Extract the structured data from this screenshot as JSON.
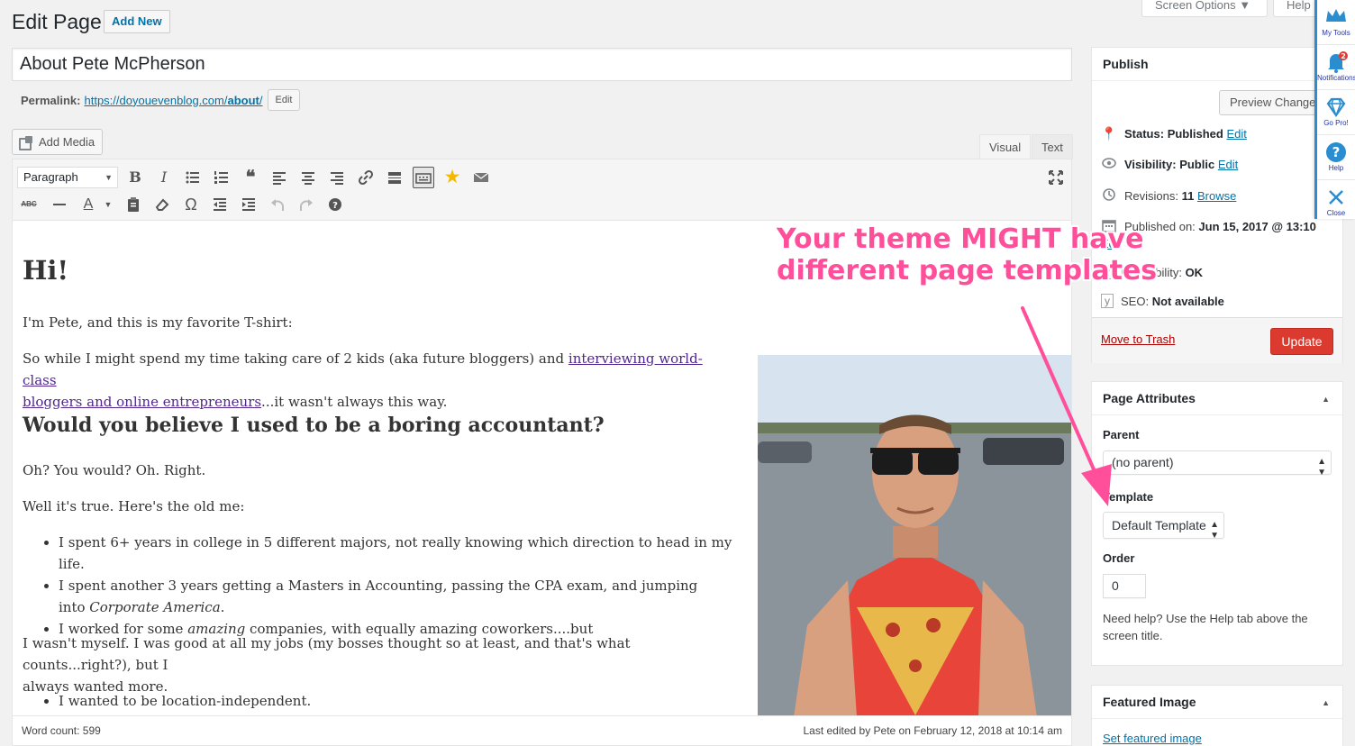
{
  "header": {
    "title": "Edit Page",
    "add_new": "Add New",
    "screen_options": "Screen Options ▼",
    "help": "Help"
  },
  "post": {
    "title": "About Pete McPherson",
    "permalink_label": "Permalink:",
    "permalink_base": "https://doyouevenblog.com/",
    "permalink_slug": "about",
    "permalink_end": "/",
    "permalink_edit": "Edit"
  },
  "editor": {
    "add_media": "Add Media",
    "tab_visual": "Visual",
    "tab_text": "Text",
    "format": "Paragraph",
    "content": {
      "h1": "Hi!",
      "p1": "I'm Pete, and this is my favorite T-shirt:",
      "p2_start": "So while I might spend my time taking care of 2 kids (aka future bloggers) and ",
      "p2_link_1": "interviewing world-class ",
      "p2_link_2": "bloggers and online entrepreneurs",
      "p2_end": "...it wasn't always this way.",
      "h2": "Would you believe I used to be a boring accountant?",
      "p3": "Oh? You would? Oh. Right.",
      "p4": "Well it's true. Here's the old me:",
      "li1": "I spent 6+ years in college in 5 different majors, not really knowing which direction to head in my life.",
      "li2_line1": "I spent another 3 years getting a Masters in Accounting, passing the CPA exam, and jumping",
      "li2_line2_pre": "into ",
      "li2_line2_em": "Corporate America",
      "li2_line2_post": ".",
      "li3_pre": "I worked for some ",
      "li3_em": "amazing",
      "li3_post": " companies, with equally amazing coworkers....but",
      "p5_line1": "I wasn't myself. I was good at all my jobs (my bosses thought so at least, and that's what counts...right?), but I",
      "p5_line2": "always wanted more.",
      "li4": "I wanted to be location-independent."
    },
    "word_count": "Word count: 599",
    "last_edited": "Last edited by Pete on February 12, 2018 at 10:14 am"
  },
  "publish": {
    "title": "Publish",
    "preview": "Preview Changes",
    "status_label": "Status:",
    "status_value": "Published",
    "visibility_label": "Visibility:",
    "visibility_value": "Public",
    "revisions_label": "Revisions:",
    "revisions_value": "11",
    "browse": "Browse",
    "published_label": "Published on:",
    "published_value": "Jun 15, 2017 @ 13:10",
    "edit": "Edit",
    "readability_label": "Readability:",
    "readability_value": "OK",
    "seo_label": "SEO:",
    "seo_value": "Not available",
    "trash": "Move to Trash",
    "update": "Update"
  },
  "attributes": {
    "title": "Page Attributes",
    "parent_label": "Parent",
    "parent_value": "(no parent)",
    "template_label": "Template",
    "template_value": "Default Template",
    "order_label": "Order",
    "order_value": "0",
    "help_text": "Need help? Use the Help tab above the screen title."
  },
  "featured": {
    "title": "Featured Image",
    "set": "Set featured image"
  },
  "side_toolbar": {
    "my_tools": "My Tools",
    "notifications": "Notifications",
    "notification_count": "2",
    "go_pro": "Go Pro!",
    "help": "Help",
    "close": "Close"
  },
  "annotation": {
    "line1": "Your theme MIGHT have",
    "line2": "different page templates"
  },
  "colors": {
    "accent": "#0073aa",
    "update_button": "#dc3a2e",
    "annotation": "#ff4f9a",
    "trash": "#a00"
  }
}
